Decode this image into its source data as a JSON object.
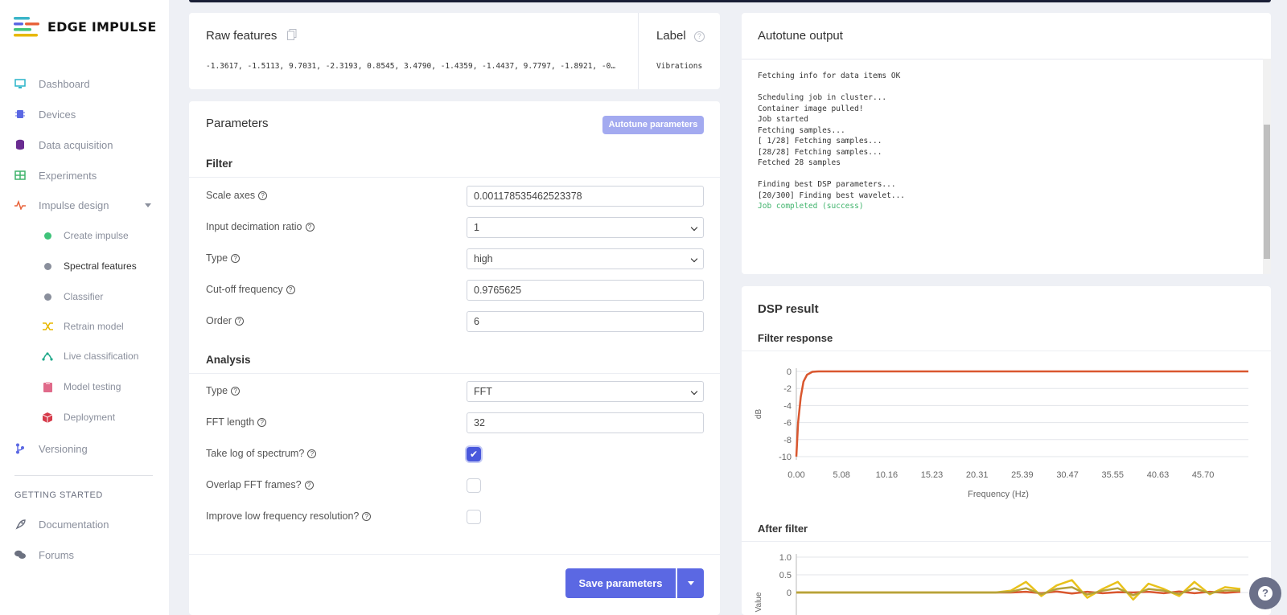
{
  "app": {
    "name": "EDGE IMPULSE"
  },
  "sidebar": {
    "items": [
      {
        "label": "Dashboard",
        "icon": "monitor-icon",
        "color": "#28b4c8"
      },
      {
        "label": "Devices",
        "icon": "chip-icon",
        "color": "#5b68e3"
      },
      {
        "label": "Data acquisition",
        "icon": "database-icon",
        "color": "#6a2c91"
      },
      {
        "label": "Experiments",
        "icon": "table-icon",
        "color": "#3fb36b"
      },
      {
        "label": "Impulse design",
        "icon": "pulse-icon",
        "color": "#e8643c"
      }
    ],
    "sub_items": [
      {
        "label": "Create impulse",
        "icon": "dot-green-icon",
        "color": "#3fc37a"
      },
      {
        "label": "Spectral features",
        "icon": "dot-gray-icon",
        "color": "#8a8f9c"
      },
      {
        "label": "Classifier",
        "icon": "dot-gray-icon",
        "color": "#8a8f9c"
      },
      {
        "label": "Retrain model",
        "icon": "shuffle-icon",
        "color": "#e8b800"
      },
      {
        "label": "Live classification",
        "icon": "live-icon",
        "color": "#1fa88a"
      },
      {
        "label": "Model testing",
        "icon": "clipboard-icon",
        "color": "#e06a8a"
      },
      {
        "label": "Deployment",
        "icon": "cube-icon",
        "color": "#d63a4a"
      }
    ],
    "versioning": {
      "label": "Versioning",
      "icon": "branch-icon",
      "color": "#5b68e3"
    },
    "getting_started_title": "GETTING STARTED",
    "getting_started": [
      {
        "label": "Documentation",
        "icon": "rocket-icon"
      },
      {
        "label": "Forums",
        "icon": "chat-icon"
      }
    ]
  },
  "raw_features": {
    "title": "Raw features",
    "values": "-1.3617, -1.5113, 9.7031, -2.3193, 0.8545, 3.4790, -1.4359, -1.4437, 9.7797, -1.8921, -0…",
    "label_title": "Label",
    "label_value": "Vibrations"
  },
  "parameters": {
    "title": "Parameters",
    "autotune_button": "Autotune parameters",
    "filter_heading": "Filter",
    "analysis_heading": "Analysis",
    "filter": {
      "scale_axes": {
        "label": "Scale axes",
        "value": "0.001178535462523378"
      },
      "input_decimation": {
        "label": "Input decimation ratio",
        "value": "1"
      },
      "type": {
        "label": "Type",
        "value": "high"
      },
      "cutoff": {
        "label": "Cut-off frequency",
        "value": "0.9765625"
      },
      "order": {
        "label": "Order",
        "value": "6"
      }
    },
    "analysis": {
      "type": {
        "label": "Type",
        "value": "FFT"
      },
      "fft_length": {
        "label": "FFT length",
        "value": "32"
      },
      "take_log": {
        "label": "Take log of spectrum?",
        "checked": true
      },
      "overlap": {
        "label": "Overlap FFT frames?",
        "checked": false
      },
      "improve_low": {
        "label": "Improve low frequency resolution?",
        "checked": false
      }
    },
    "save_button": "Save parameters"
  },
  "autotune": {
    "title": "Autotune output",
    "lines": [
      "Fetching info for data items OK",
      "",
      "Scheduling job in cluster...",
      "Container image pulled!",
      "Job started",
      "Fetching samples...",
      "[ 1/28] Fetching samples...",
      "[28/28] Fetching samples...",
      "Fetched 28 samples",
      "",
      "Finding best DSP parameters...",
      "[20/300] Finding best wavelet..."
    ],
    "success_line": "Job completed (success)"
  },
  "dsp": {
    "title": "DSP result",
    "filter_response_title": "Filter response",
    "after_filter_title": "After filter"
  },
  "chart_data": [
    {
      "type": "line",
      "title": "Filter response",
      "xlabel": "Frequency (Hz)",
      "ylabel": "dB",
      "x_ticks": [
        "0.00",
        "5.08",
        "10.16",
        "15.23",
        "20.31",
        "25.39",
        "30.47",
        "35.55",
        "40.63",
        "45.70"
      ],
      "y_ticks": [
        "0",
        "-2",
        "-4",
        "-6",
        "-8",
        "-10"
      ],
      "xlim": [
        0,
        50.8
      ],
      "ylim": [
        -10,
        0
      ],
      "series": [
        {
          "color": "#d9572f",
          "x": [
            0,
            0.2,
            0.5,
            0.8,
            1.2,
            1.8,
            2.5,
            50.8
          ],
          "y": [
            -10,
            -6,
            -3,
            -1.2,
            -0.4,
            -0.05,
            0,
            0
          ]
        }
      ]
    },
    {
      "type": "line",
      "title": "After filter",
      "ylabel": "Value",
      "y_ticks": [
        "1.0",
        "0.5",
        "0"
      ],
      "ylim": [
        -0.4,
        1.0
      ],
      "series": [
        {
          "color": "#d9572f",
          "values": [
            0,
            0,
            0,
            0,
            0,
            0,
            0,
            0,
            0,
            0,
            0,
            0,
            0,
            0,
            0,
            0.02,
            -0.02,
            0.03,
            -0.03,
            0.02,
            -0.02,
            0.01,
            0,
            0.02,
            -0.02,
            0.03,
            -0.02,
            0.02,
            -0.01,
            0.02
          ]
        },
        {
          "color": "#e8c11a",
          "values": [
            0,
            0,
            0,
            0,
            0,
            0,
            0,
            0,
            0,
            0,
            0,
            0,
            0,
            0,
            0.05,
            0.3,
            -0.1,
            0.2,
            0.35,
            -0.15,
            0.1,
            0.3,
            -0.2,
            0.25,
            0.1,
            -0.1,
            0.3,
            -0.05,
            0.15,
            0.1
          ]
        },
        {
          "color": "#b5a33a",
          "values": [
            0,
            0,
            0,
            0,
            0,
            0,
            0,
            0,
            0,
            0,
            0,
            0,
            0,
            0,
            0.02,
            0.12,
            -0.05,
            0.1,
            0.15,
            -0.06,
            0.05,
            0.12,
            -0.08,
            0.1,
            0.05,
            -0.04,
            0.12,
            -0.02,
            0.06,
            0.05
          ]
        }
      ]
    }
  ]
}
